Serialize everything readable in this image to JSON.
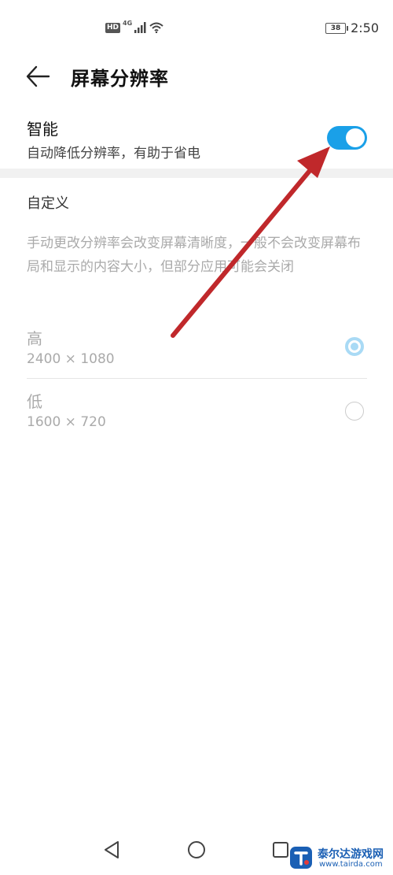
{
  "status_bar": {
    "hd": "HD",
    "network": "4G",
    "battery": "38",
    "time": "2:50"
  },
  "header": {
    "title": "屏幕分辨率"
  },
  "smart": {
    "title": "智能",
    "subtitle": "自动降低分辨率，有助于省电",
    "enabled": true
  },
  "custom": {
    "header": "自定义",
    "description": "手动更改分辨率会改变屏幕清晰度，一般不会改变屏幕布局和显示的内容大小，但部分应用可能会关闭"
  },
  "options": [
    {
      "title": "高",
      "resolution": "2400 × 1080",
      "selected": true
    },
    {
      "title": "低",
      "resolution": "1600 × 720",
      "selected": false
    }
  ],
  "watermark": {
    "name": "泰尔达游戏网",
    "url": "www.tairda.com"
  },
  "colors": {
    "accent": "#1aa0e8",
    "radio_selected": "#a9daf5",
    "annotation_arrow": "#c0282b"
  }
}
